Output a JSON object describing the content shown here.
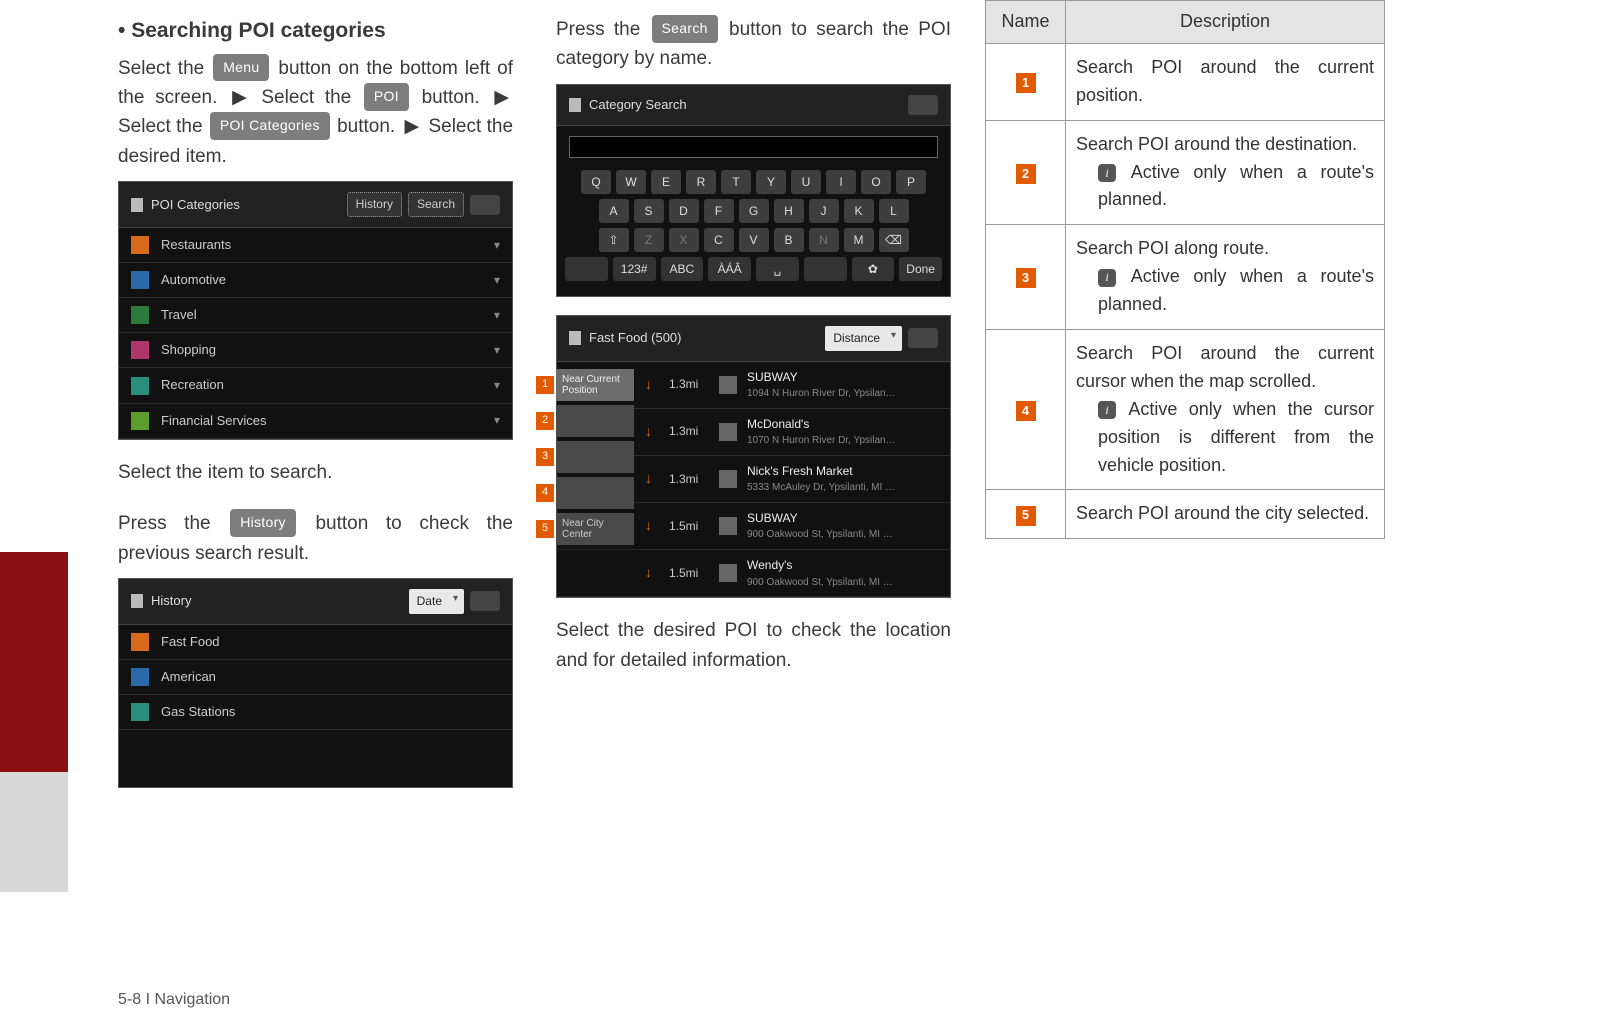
{
  "col1": {
    "heading": "Searching POI categories",
    "p1_a": "Select the ",
    "menu_label": "Menu",
    "p1_b": " button on the bottom left of the screen. ",
    "p1_c": " Select the ",
    "poi_label": "POI",
    "p1_d": " button. ",
    "p1_e": " Select the ",
    "poi_cat_label": "POI Categories",
    "p1_f": " button. ",
    "p1_g": " Select the desired item.",
    "shot1": {
      "title": "POI Categories",
      "btn_history": "History",
      "btn_search": "Search",
      "rows": [
        "Restaurants",
        "Automotive",
        "Travel",
        "Shopping",
        "Recreation",
        "Financial Services"
      ]
    },
    "select_item": "Select the item to search.",
    "p2_a": "Press the ",
    "history_label": "History",
    "p2_b": " button to check the previous search result.",
    "shot2": {
      "title": "History",
      "dropdown": "Date",
      "rows": [
        "Fast Food",
        "American",
        "Gas Stations"
      ]
    }
  },
  "col2": {
    "p1_a": "Press the ",
    "search_label": "Search",
    "p1_b": " button to search the POI category by name.",
    "shot_kbd": {
      "title": "Category Search",
      "row1": [
        "Q",
        "W",
        "E",
        "R",
        "T",
        "Y",
        "U",
        "I",
        "O",
        "P"
      ],
      "row2": [
        "A",
        "S",
        "D",
        "F",
        "G",
        "H",
        "J",
        "K",
        "L"
      ],
      "row3": [
        "⇧",
        "Z",
        "X",
        "C",
        "V",
        "B",
        "N",
        "M",
        "⌫"
      ],
      "row4": [
        "",
        "123#",
        "ABC",
        "ÀÁÂ",
        "␣",
        "",
        "✿",
        "Done"
      ]
    },
    "shot_ff": {
      "title": "Fast Food (500)",
      "dropdown": "Distance",
      "tabs": [
        {
          "num": "1",
          "label": "Near Current Position",
          "light": true
        },
        {
          "num": "2",
          "label": "",
          "light": false
        },
        {
          "num": "3",
          "label": "",
          "light": false
        },
        {
          "num": "4",
          "label": "",
          "light": false
        },
        {
          "num": "5",
          "label": "Near City Center",
          "light": false
        }
      ],
      "rows": [
        {
          "dist": "1.3mi",
          "name": "SUBWAY",
          "addr": "1094 N Huron River Dr, Ypsilan…"
        },
        {
          "dist": "1.3mi",
          "name": "McDonald's",
          "addr": "1070 N Huron River Dr, Ypsilan…"
        },
        {
          "dist": "1.3mi",
          "name": "Nick's Fresh Market",
          "addr": "5333 McAuley Dr, Ypsilanti, MI …"
        },
        {
          "dist": "1.5mi",
          "name": "SUBWAY",
          "addr": "900 Oakwood St, Ypsilanti, MI …"
        },
        {
          "dist": "1.5mi",
          "name": "Wendy's",
          "addr": "900 Oakwood St, Ypsilanti, MI …"
        }
      ]
    },
    "caption": "Select the desired POI to check the location and for detailed information."
  },
  "col3": {
    "header_name": "Name",
    "header_desc": "Description",
    "rows": [
      {
        "num": "1",
        "desc": "Search POI around the current position.",
        "info": null
      },
      {
        "num": "2",
        "desc": "Search POI around the destination.",
        "info": "Active only when a route's planned."
      },
      {
        "num": "3",
        "desc": "Search POI along route.",
        "info": "Active only when a route's planned."
      },
      {
        "num": "4",
        "desc": "Search POI around the current cursor when the map scrolled.",
        "info": "Active only when  the cursor position is different from the vehicle position."
      },
      {
        "num": "5",
        "desc": "Search POI around the city selected.",
        "info": null
      }
    ]
  },
  "footer": "5-8 I Navigation"
}
